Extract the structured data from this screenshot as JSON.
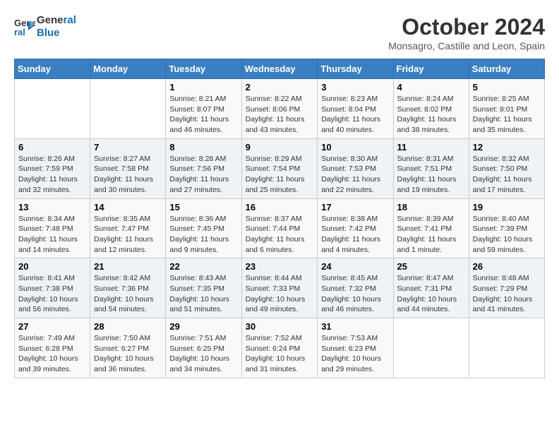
{
  "logo": {
    "line1": "General",
    "line2": "Blue"
  },
  "title": "October 2024",
  "subtitle": "Monsagro, Castille and Leon, Spain",
  "days_header": [
    "Sunday",
    "Monday",
    "Tuesday",
    "Wednesday",
    "Thursday",
    "Friday",
    "Saturday"
  ],
  "weeks": [
    [
      {
        "day": "",
        "info": ""
      },
      {
        "day": "",
        "info": ""
      },
      {
        "day": "1",
        "info": "Sunrise: 8:21 AM\nSunset: 8:07 PM\nDaylight: 11 hours and 46 minutes."
      },
      {
        "day": "2",
        "info": "Sunrise: 8:22 AM\nSunset: 8:06 PM\nDaylight: 11 hours and 43 minutes."
      },
      {
        "day": "3",
        "info": "Sunrise: 8:23 AM\nSunset: 8:04 PM\nDaylight: 11 hours and 40 minutes."
      },
      {
        "day": "4",
        "info": "Sunrise: 8:24 AM\nSunset: 8:02 PM\nDaylight: 11 hours and 38 minutes."
      },
      {
        "day": "5",
        "info": "Sunrise: 8:25 AM\nSunset: 8:01 PM\nDaylight: 11 hours and 35 minutes."
      }
    ],
    [
      {
        "day": "6",
        "info": "Sunrise: 8:26 AM\nSunset: 7:59 PM\nDaylight: 11 hours and 32 minutes."
      },
      {
        "day": "7",
        "info": "Sunrise: 8:27 AM\nSunset: 7:58 PM\nDaylight: 11 hours and 30 minutes."
      },
      {
        "day": "8",
        "info": "Sunrise: 8:28 AM\nSunset: 7:56 PM\nDaylight: 11 hours and 27 minutes."
      },
      {
        "day": "9",
        "info": "Sunrise: 8:29 AM\nSunset: 7:54 PM\nDaylight: 11 hours and 25 minutes."
      },
      {
        "day": "10",
        "info": "Sunrise: 8:30 AM\nSunset: 7:53 PM\nDaylight: 11 hours and 22 minutes."
      },
      {
        "day": "11",
        "info": "Sunrise: 8:31 AM\nSunset: 7:51 PM\nDaylight: 11 hours and 19 minutes."
      },
      {
        "day": "12",
        "info": "Sunrise: 8:32 AM\nSunset: 7:50 PM\nDaylight: 11 hours and 17 minutes."
      }
    ],
    [
      {
        "day": "13",
        "info": "Sunrise: 8:34 AM\nSunset: 7:48 PM\nDaylight: 11 hours and 14 minutes."
      },
      {
        "day": "14",
        "info": "Sunrise: 8:35 AM\nSunset: 7:47 PM\nDaylight: 11 hours and 12 minutes."
      },
      {
        "day": "15",
        "info": "Sunrise: 8:36 AM\nSunset: 7:45 PM\nDaylight: 11 hours and 9 minutes."
      },
      {
        "day": "16",
        "info": "Sunrise: 8:37 AM\nSunset: 7:44 PM\nDaylight: 11 hours and 6 minutes."
      },
      {
        "day": "17",
        "info": "Sunrise: 8:38 AM\nSunset: 7:42 PM\nDaylight: 11 hours and 4 minutes."
      },
      {
        "day": "18",
        "info": "Sunrise: 8:39 AM\nSunset: 7:41 PM\nDaylight: 11 hours and 1 minute."
      },
      {
        "day": "19",
        "info": "Sunrise: 8:40 AM\nSunset: 7:39 PM\nDaylight: 10 hours and 59 minutes."
      }
    ],
    [
      {
        "day": "20",
        "info": "Sunrise: 8:41 AM\nSunset: 7:38 PM\nDaylight: 10 hours and 56 minutes."
      },
      {
        "day": "21",
        "info": "Sunrise: 8:42 AM\nSunset: 7:36 PM\nDaylight: 10 hours and 54 minutes."
      },
      {
        "day": "22",
        "info": "Sunrise: 8:43 AM\nSunset: 7:35 PM\nDaylight: 10 hours and 51 minutes."
      },
      {
        "day": "23",
        "info": "Sunrise: 8:44 AM\nSunset: 7:33 PM\nDaylight: 10 hours and 49 minutes."
      },
      {
        "day": "24",
        "info": "Sunrise: 8:45 AM\nSunset: 7:32 PM\nDaylight: 10 hours and 46 minutes."
      },
      {
        "day": "25",
        "info": "Sunrise: 8:47 AM\nSunset: 7:31 PM\nDaylight: 10 hours and 44 minutes."
      },
      {
        "day": "26",
        "info": "Sunrise: 8:48 AM\nSunset: 7:29 PM\nDaylight: 10 hours and 41 minutes."
      }
    ],
    [
      {
        "day": "27",
        "info": "Sunrise: 7:49 AM\nSunset: 6:28 PM\nDaylight: 10 hours and 39 minutes."
      },
      {
        "day": "28",
        "info": "Sunrise: 7:50 AM\nSunset: 6:27 PM\nDaylight: 10 hours and 36 minutes."
      },
      {
        "day": "29",
        "info": "Sunrise: 7:51 AM\nSunset: 6:25 PM\nDaylight: 10 hours and 34 minutes."
      },
      {
        "day": "30",
        "info": "Sunrise: 7:52 AM\nSunset: 6:24 PM\nDaylight: 10 hours and 31 minutes."
      },
      {
        "day": "31",
        "info": "Sunrise: 7:53 AM\nSunset: 6:23 PM\nDaylight: 10 hours and 29 minutes."
      },
      {
        "day": "",
        "info": ""
      },
      {
        "day": "",
        "info": ""
      }
    ]
  ]
}
